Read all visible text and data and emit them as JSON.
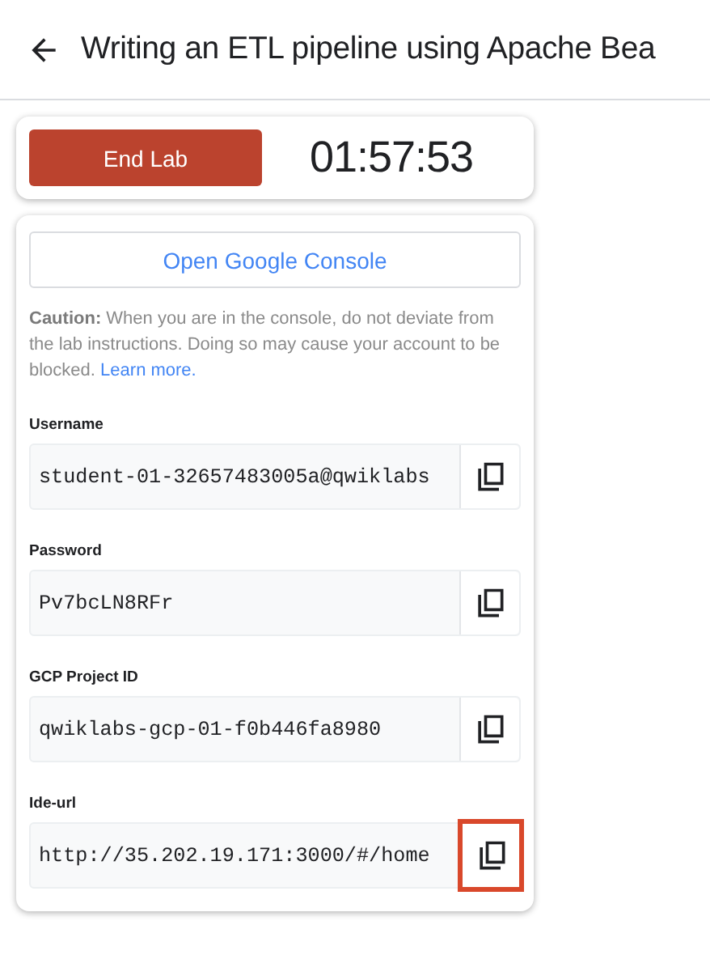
{
  "header": {
    "title": "Writing an ETL pipeline using Apache Bea"
  },
  "lab_controls": {
    "end_button": "End Lab",
    "timer": "01:57:53"
  },
  "console_button": "Open Google Console",
  "caution": {
    "label": "Caution:",
    "text": "When you are in the console, do not deviate from the lab instructions. Doing so may cause your account to be blocked.",
    "link": "Learn more."
  },
  "fields": [
    {
      "label": "Username",
      "value": "student-01-32657483005a@qwiklabs",
      "highlighted": false
    },
    {
      "label": "Password",
      "value": "Pv7bcLN8RFr",
      "highlighted": false
    },
    {
      "label": "GCP Project ID",
      "value": "qwiklabs-gcp-01-f0b446fa8980",
      "highlighted": false
    },
    {
      "label": "Ide-url",
      "value": "http://35.202.19.171:3000/#/home",
      "highlighted": true
    }
  ]
}
